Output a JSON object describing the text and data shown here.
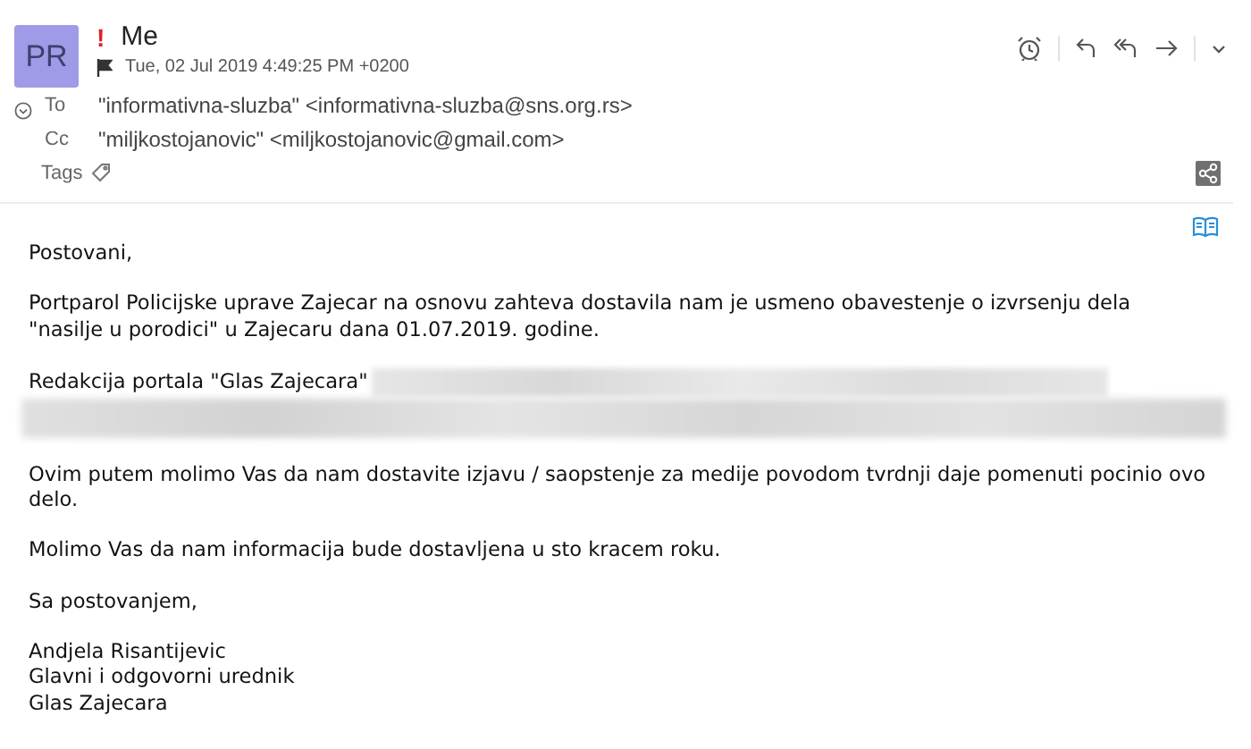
{
  "header": {
    "avatar": "PR",
    "important": true,
    "important_mark": "!",
    "sender": "Me",
    "flagged": true,
    "date": "Tue, 02 Jul 2019 4:49:25 PM +0200"
  },
  "recipients": [
    {
      "label": "To",
      "value": "\"informativna-sluzba\" <informativna-sluzba@sns.org.rs>"
    },
    {
      "label": "Cc",
      "value": "\"miljkostojanovic\" <miljkostojanovic@gmail.com>"
    }
  ],
  "tags_label": "Tags",
  "body": [
    {
      "kind": "text",
      "lines": [
        "Postovani,"
      ]
    },
    {
      "kind": "text",
      "lines": [
        "Portparol Policijske uprave Zajecar na osnovu zahteva dostavila nam je usmeno obavestenje o izvrsenju dela",
        "\"nasilje u porodici\" u Zajecaru dana 01.07.2019. godine."
      ]
    },
    {
      "kind": "redacted",
      "lines": [
        "Redakcija portala \"Glas Zajecara\""
      ]
    },
    {
      "kind": "text",
      "lines": [
        "Ovim putem molimo Vas da nam dostavite izjavu / saopstenje za medije povodom tvrdnji daje pomenuti pocinio ovo",
        "delo."
      ]
    },
    {
      "kind": "text",
      "lines": [
        "Molimo Vas da nam informacija bude dostavljena u sto kracem roku."
      ]
    },
    {
      "kind": "text",
      "lines": [
        "Sa postovanjem,"
      ]
    },
    {
      "kind": "text",
      "lines": [
        "Andjela Risantijevic",
        "Glavni i odgovorni urednik",
        "Glas Zajecara"
      ]
    }
  ]
}
